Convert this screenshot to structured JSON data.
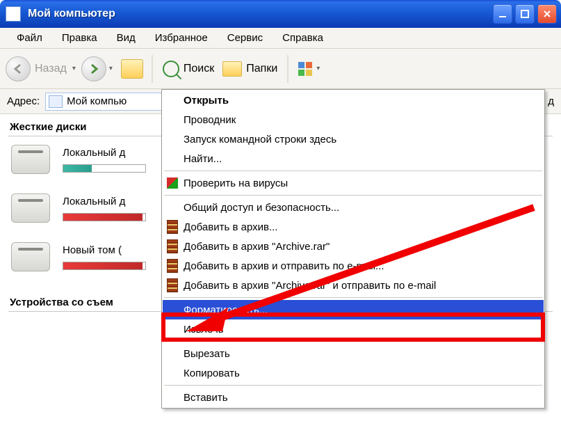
{
  "window_title": "Мой компьютер",
  "menubar": [
    "Файл",
    "Правка",
    "Вид",
    "Избранное",
    "Сервис",
    "Справка"
  ],
  "toolbar": {
    "back": "Назад",
    "search": "Поиск",
    "folders": "Папки"
  },
  "addressbar": {
    "label": "Адрес:",
    "value": "Мой компью",
    "right_fragment": "д"
  },
  "sections": {
    "hdd": "Жесткие диски",
    "removable": "Устройства со съем"
  },
  "drives": [
    {
      "label": "Локальный д",
      "fill_pct": 35,
      "fill_color": "teal"
    },
    {
      "label": "Локальный д",
      "fill_pct": 97,
      "fill_color": "red"
    },
    {
      "label": "Новый том (",
      "fill_pct": 97,
      "fill_color": "red"
    }
  ],
  "context_menu": {
    "items": [
      {
        "label": "Открыть",
        "icon": null,
        "highlighted": false
      },
      {
        "label": "Проводник",
        "icon": null
      },
      {
        "label": "Запуск командной строки здесь",
        "icon": null
      },
      {
        "label": "Найти...",
        "icon": null
      },
      {
        "sep": true
      },
      {
        "label": "Проверить на вирусы",
        "icon": "kaspersky"
      },
      {
        "sep": true
      },
      {
        "label": "Общий доступ и безопасность...",
        "icon": null
      },
      {
        "label": "Добавить в архив...",
        "icon": "rar"
      },
      {
        "label": "Добавить в архив \"Archive.rar\"",
        "icon": "rar"
      },
      {
        "label": "Добавить в архив и отправить по e-mail...",
        "icon": "rar"
      },
      {
        "label": "Добавить в архив \"Archive.rar\" и отправить по e-mail",
        "icon": "rar"
      },
      {
        "sep": true
      },
      {
        "label": "Форматировать...",
        "icon": null,
        "highlighted": true
      },
      {
        "label": "Извлечь",
        "icon": null
      },
      {
        "sep": true
      },
      {
        "label": "Вырезать",
        "icon": null
      },
      {
        "label": "Копировать",
        "icon": null
      },
      {
        "sep": true
      },
      {
        "label": "Вставить",
        "icon": null
      }
    ]
  },
  "dropdown_glyph": "▾"
}
